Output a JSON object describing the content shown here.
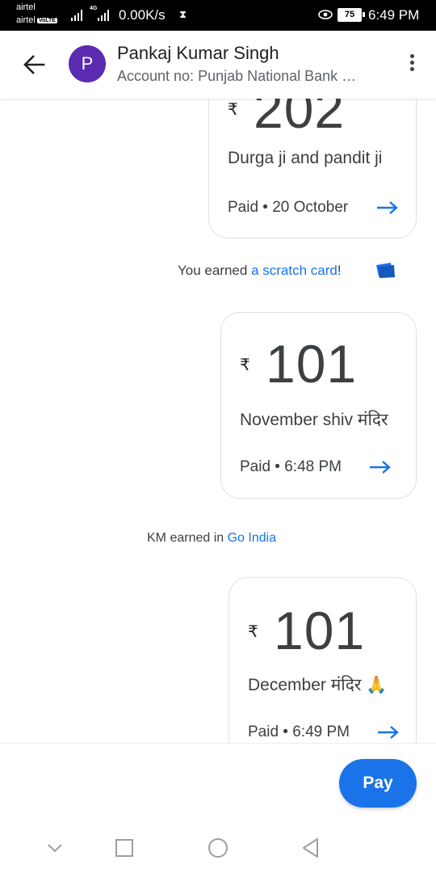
{
  "status_bar": {
    "carrier_1": "airtel",
    "carrier_2": "airtel",
    "volte_badge": "VoLTE",
    "network_type": "4G",
    "data_speed": "0.00K/s",
    "battery_level": "75",
    "time": "6:49 PM"
  },
  "header": {
    "contact_name": "Pankaj Kumar Singh",
    "avatar_letter": "P",
    "account_info": "Account no: Punjab National Bank …"
  },
  "transactions": [
    {
      "currency_symbol": "₹",
      "amount": "202",
      "note": "Durga ji and pandit ji",
      "status": "Paid • 20 October"
    },
    {
      "currency_symbol": "₹",
      "amount": "101",
      "note": "November shiv मंदिर",
      "status": "Paid • 6:48 PM"
    },
    {
      "currency_symbol": "₹",
      "amount": "101",
      "note": "December मंदिर 🙏",
      "status": "Paid • 6:49 PM"
    }
  ],
  "system_messages": {
    "scratch_prefix": "You earned ",
    "scratch_link": "a scratch card",
    "scratch_suffix": "!",
    "earned_prefix": "KM earned in ",
    "earned_link": "Go India"
  },
  "actions": {
    "pay_label": "Pay"
  },
  "colors": {
    "accent_blue": "#1a73e8",
    "avatar_purple": "#5a2ab0"
  },
  "icons": {
    "back": "arrow-back-icon",
    "more": "more-vert-icon",
    "scratch": "scratch-card-icon",
    "detail_arrow": "arrow-forward-icon",
    "nav_back": "nav-back-icon",
    "nav_home": "nav-home-icon",
    "nav_recents": "nav-recents-icon",
    "nav_down": "nav-collapse-icon"
  }
}
